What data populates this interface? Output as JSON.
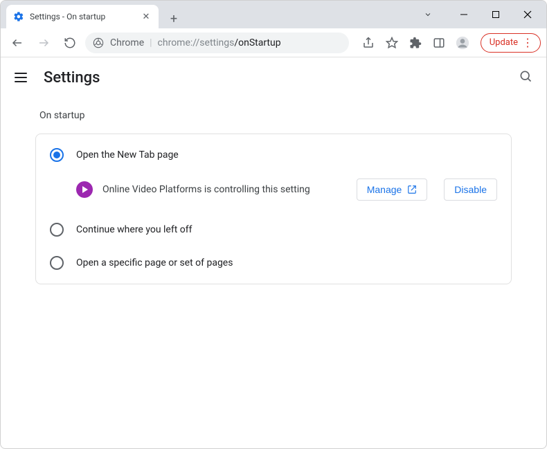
{
  "window": {
    "tab_title": "Settings - On startup",
    "update_label": "Update"
  },
  "toolbar": {
    "chrome_label": "Chrome",
    "url": "chrome://settings/onStartup",
    "url_prefix": "chrome://settings",
    "url_suffix": "/onStartup"
  },
  "header": {
    "title": "Settings"
  },
  "startup": {
    "section_label": "On startup",
    "options": [
      {
        "label": "Open the New Tab page",
        "selected": true
      },
      {
        "label": "Continue where you left off",
        "selected": false
      },
      {
        "label": "Open a specific page or set of pages",
        "selected": false
      }
    ],
    "extension_notice": "Online Video Platforms is controlling this setting",
    "manage_label": "Manage",
    "disable_label": "Disable"
  }
}
